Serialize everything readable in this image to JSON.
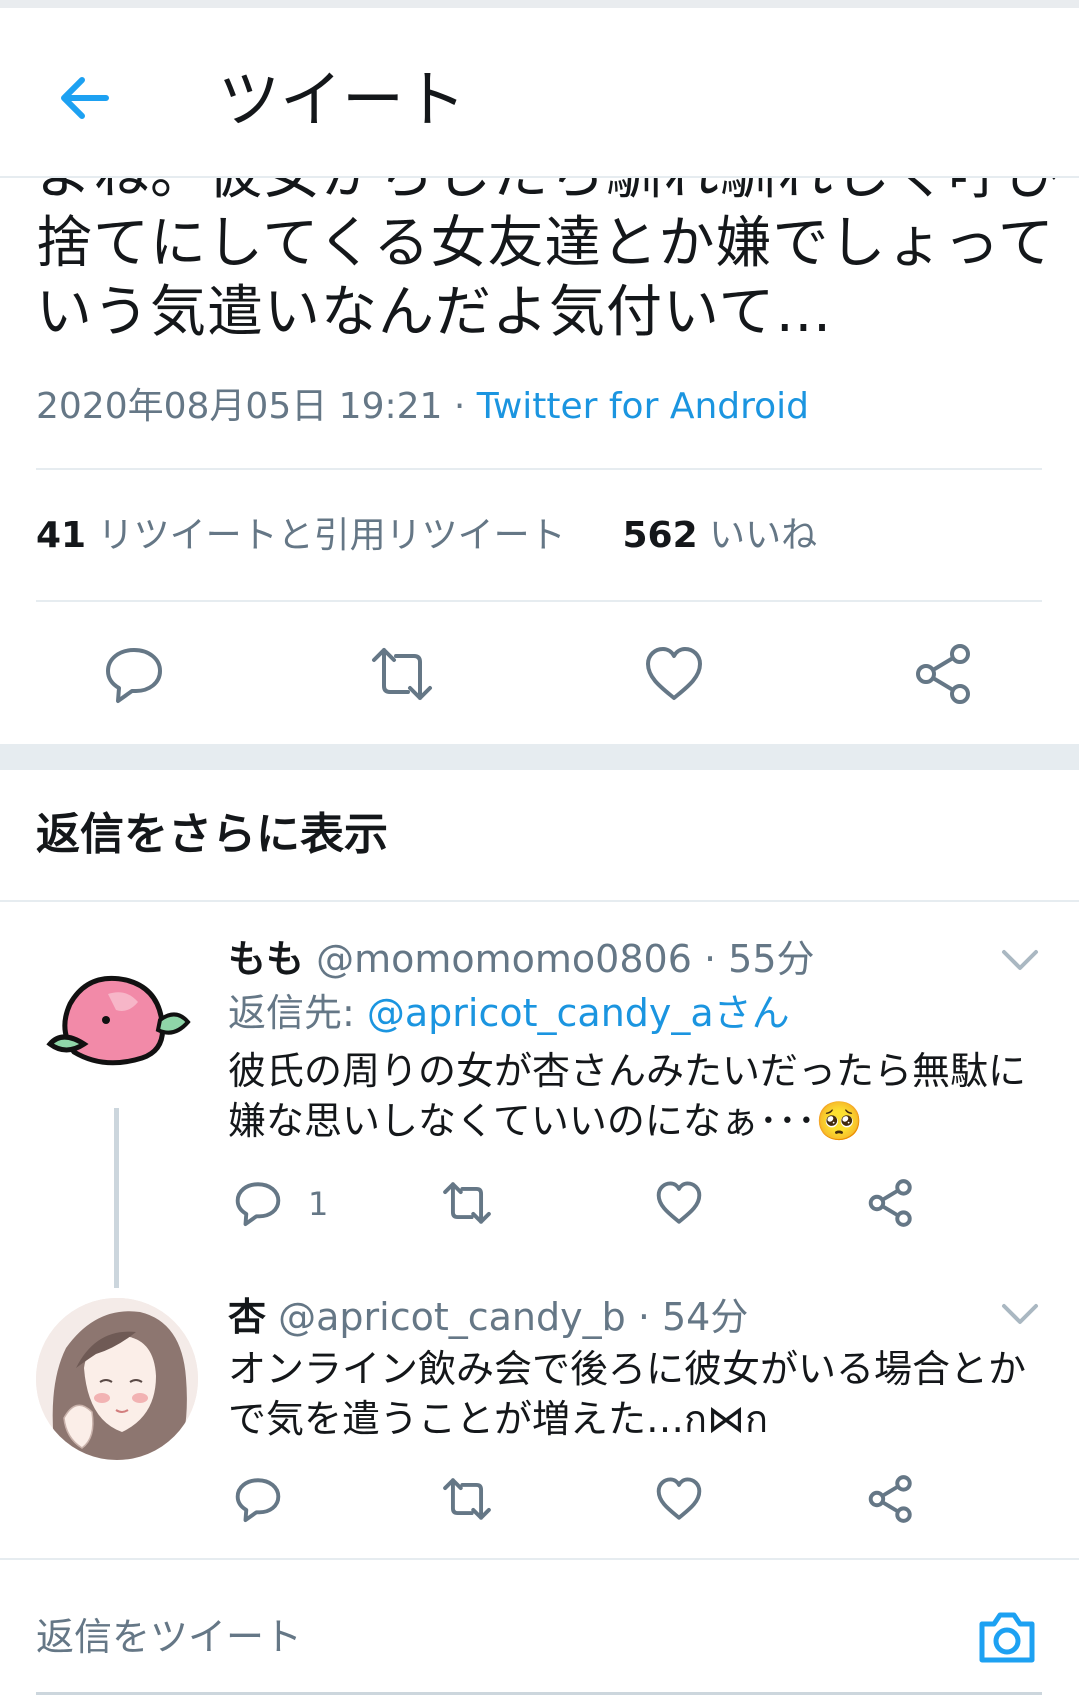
{
  "header": {
    "title": "ツイート",
    "back_icon": "arrow-left-icon"
  },
  "tweet": {
    "text_lines": [
      "よね。彼女からしたら馴れ馴れしく呼び",
      "捨てにしてくる女友達とか嫌でしょって",
      "いう気遣いなんだよ気付いて…"
    ],
    "timestamp": "2020年08月05日 19:21",
    "separator": " · ",
    "source": "Twitter for Android",
    "retweet_count": "41",
    "retweet_label": "リツイートと引用リツイート",
    "like_count": "562",
    "like_label": "いいね"
  },
  "more_replies": "返信をさらに表示",
  "replies": [
    {
      "name": "もも",
      "handle": "@momomomo0806",
      "time": "55分",
      "reply_to_prefix": "返信先: ",
      "reply_to": "@apricot_candy_aさん",
      "lines": [
        "彼氏の周りの女が杏さんみたいだったら無駄に",
        "嫌な思いしなくていいのになぁ･･･🥺"
      ],
      "reply_count": "1"
    },
    {
      "name": "杏",
      "handle": "@apricot_candy_b",
      "time": "54分",
      "lines": [
        "オンライン飲み会で後ろに彼女がいる場合とか",
        "で気を遣うことが増えた…ก⋈ก"
      ]
    }
  ],
  "compose": {
    "placeholder": "返信をツイート",
    "camera_icon": "camera-icon"
  },
  "colors": {
    "accent": "#1da1f2",
    "link": "#1b95e0",
    "secondary": "#657786",
    "divider": "#e6ecf0"
  }
}
